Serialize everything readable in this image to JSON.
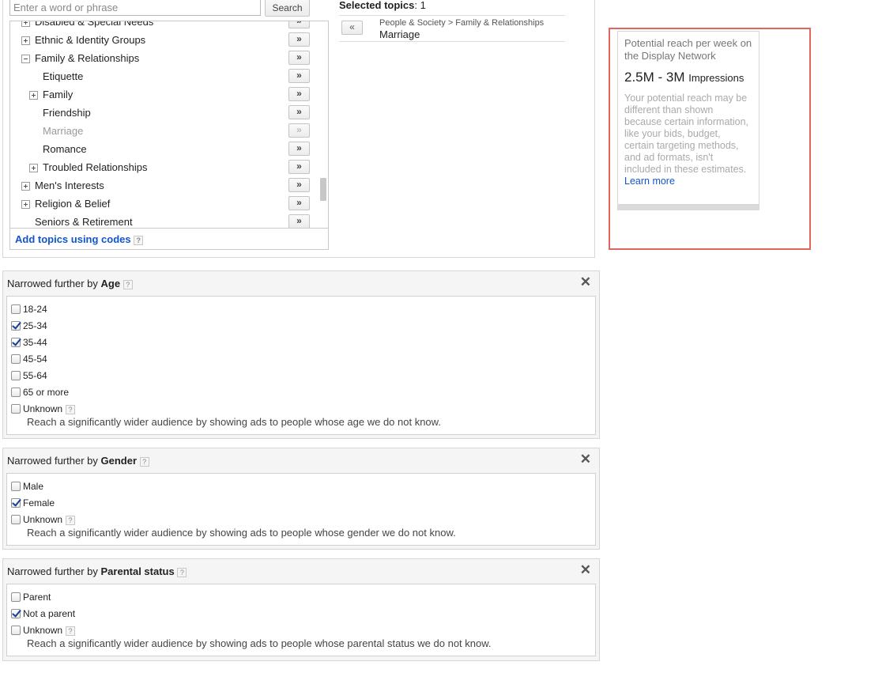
{
  "search": {
    "placeholder": "Enter a word or phrase",
    "button_label": "Search"
  },
  "tree": {
    "items": [
      {
        "label": "Disabled & Special Needs",
        "expandable": true,
        "expanded": false,
        "disabled": false
      },
      {
        "label": "Ethnic & Identity Groups",
        "expandable": true,
        "expanded": false,
        "disabled": false
      },
      {
        "label": "Family & Relationships",
        "expandable": true,
        "expanded": true,
        "disabled": false
      },
      {
        "label": "Etiquette",
        "expandable": false,
        "expanded": false,
        "disabled": false
      },
      {
        "label": "Family",
        "expandable": true,
        "expanded": false,
        "disabled": false
      },
      {
        "label": "Friendship",
        "expandable": false,
        "expanded": false,
        "disabled": false
      },
      {
        "label": "Marriage",
        "expandable": false,
        "expanded": false,
        "disabled": true
      },
      {
        "label": "Romance",
        "expandable": false,
        "expanded": false,
        "disabled": false
      },
      {
        "label": "Troubled Relationships",
        "expandable": true,
        "expanded": false,
        "disabled": false
      },
      {
        "label": "Men's Interests",
        "expandable": true,
        "expanded": false,
        "disabled": false
      },
      {
        "label": "Religion & Belief",
        "expandable": true,
        "expanded": false,
        "disabled": false
      },
      {
        "label": "Seniors & Retirement",
        "expandable": false,
        "expanded": false,
        "disabled": false
      }
    ],
    "add_button_label": "»",
    "add_codes_label": "Add topics using codes",
    "help_label": "?"
  },
  "selected": {
    "title": "Selected topics",
    "count": ": 1",
    "remove_label": "«",
    "items": [
      {
        "path": "People & Society > Family & Relationships",
        "name": "Marriage"
      }
    ]
  },
  "reach": {
    "title": "Potential reach per week on the Display Network",
    "value": "2.5M - 3M",
    "unit": "Impressions",
    "note": "Your potential reach may be different than shown because certain information, like your bids, budget, certain targeting methods, and ad formats, isn't included in these estimates.",
    "learn_more": "Learn more"
  },
  "panels": {
    "prefix": "Narrowed further by",
    "close_label": "✕",
    "help_label": "?",
    "age": {
      "title": "Age",
      "options": [
        {
          "label": "18-24",
          "checked": false
        },
        {
          "label": "25-34",
          "checked": true
        },
        {
          "label": "35-44",
          "checked": true
        },
        {
          "label": "45-54",
          "checked": false
        },
        {
          "label": "55-64",
          "checked": false
        },
        {
          "label": "65 or more",
          "checked": false
        },
        {
          "label": "Unknown",
          "checked": false,
          "help": true
        }
      ],
      "note": "Reach a significantly wider audience by showing ads to people whose age we do not know."
    },
    "gender": {
      "title": "Gender",
      "options": [
        {
          "label": "Male",
          "checked": false
        },
        {
          "label": "Female",
          "checked": true
        },
        {
          "label": "Unknown",
          "checked": false,
          "help": true
        }
      ],
      "note": "Reach a significantly wider audience by showing ads to people whose gender we do not know."
    },
    "parental": {
      "title": "Parental status",
      "options": [
        {
          "label": "Parent",
          "checked": false
        },
        {
          "label": "Not a parent",
          "checked": true
        },
        {
          "label": "Unknown",
          "checked": false,
          "help": true
        }
      ],
      "note": "Reach a significantly wider audience by showing ads to people whose parental status we do not know."
    }
  }
}
